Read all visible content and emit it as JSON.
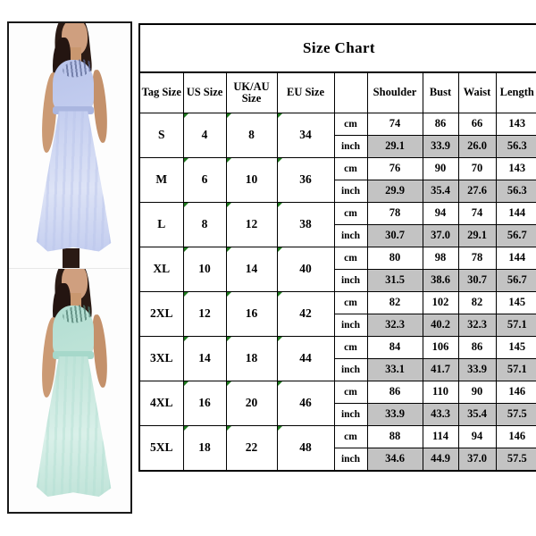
{
  "chart_data": {
    "type": "table",
    "title": "Size Chart",
    "unit_labels": [
      "cm",
      "inch"
    ],
    "columns": [
      "Tag Size",
      "US Size",
      "UK/AU Size",
      "EU Size",
      "",
      "Shoulder",
      "Bust",
      "Waist",
      "Length"
    ],
    "measure_columns": [
      "Shoulder",
      "Bust",
      "Waist",
      "Length"
    ],
    "rows": [
      {
        "tag": "S",
        "us": "4",
        "uk_au": "8",
        "eu": "34",
        "cm": {
          "shoulder": "74",
          "bust": "86",
          "waist": "66",
          "length": "143"
        },
        "inch": {
          "shoulder": "29.1",
          "bust": "33.9",
          "waist": "26.0",
          "length": "56.3"
        }
      },
      {
        "tag": "M",
        "us": "6",
        "uk_au": "10",
        "eu": "36",
        "cm": {
          "shoulder": "76",
          "bust": "90",
          "waist": "70",
          "length": "143"
        },
        "inch": {
          "shoulder": "29.9",
          "bust": "35.4",
          "waist": "27.6",
          "length": "56.3"
        }
      },
      {
        "tag": "L",
        "us": "8",
        "uk_au": "12",
        "eu": "38",
        "cm": {
          "shoulder": "78",
          "bust": "94",
          "waist": "74",
          "length": "144"
        },
        "inch": {
          "shoulder": "30.7",
          "bust": "37.0",
          "waist": "29.1",
          "length": "56.7"
        }
      },
      {
        "tag": "XL",
        "us": "10",
        "uk_au": "14",
        "eu": "40",
        "cm": {
          "shoulder": "80",
          "bust": "98",
          "waist": "78",
          "length": "144"
        },
        "inch": {
          "shoulder": "31.5",
          "bust": "38.6",
          "waist": "30.7",
          "length": "56.7"
        }
      },
      {
        "tag": "2XL",
        "us": "12",
        "uk_au": "16",
        "eu": "42",
        "cm": {
          "shoulder": "82",
          "bust": "102",
          "waist": "82",
          "length": "145"
        },
        "inch": {
          "shoulder": "32.3",
          "bust": "40.2",
          "waist": "32.3",
          "length": "57.1"
        }
      },
      {
        "tag": "3XL",
        "us": "14",
        "uk_au": "18",
        "eu": "44",
        "cm": {
          "shoulder": "84",
          "bust": "106",
          "waist": "86",
          "length": "145"
        },
        "inch": {
          "shoulder": "33.1",
          "bust": "41.7",
          "waist": "33.9",
          "length": "57.1"
        }
      },
      {
        "tag": "4XL",
        "us": "16",
        "uk_au": "20",
        "eu": "46",
        "cm": {
          "shoulder": "86",
          "bust": "110",
          "waist": "90",
          "length": "146"
        },
        "inch": {
          "shoulder": "33.9",
          "bust": "43.3",
          "waist": "35.4",
          "length": "57.5"
        }
      },
      {
        "tag": "5XL",
        "us": "18",
        "uk_au": "22",
        "eu": "48",
        "cm": {
          "shoulder": "88",
          "bust": "114",
          "waist": "94",
          "length": "146"
        },
        "inch": {
          "shoulder": "34.6",
          "bust": "44.9",
          "waist": "37.0",
          "length": "57.5"
        }
      }
    ]
  },
  "table": {
    "title": "Size Chart",
    "headers": {
      "tag": "Tag Size",
      "us": "US Size",
      "uk_au": "UK/AU Size",
      "eu": "EU Size",
      "unit": "",
      "shoulder": "Shoulder",
      "bust": "Bust",
      "waist": "Waist",
      "length": "Length"
    },
    "units": {
      "cm": "cm",
      "inch": "inch"
    }
  },
  "photos": [
    {
      "alt": "model-wearing-lavender-sleeveless-lace-chiffon-maxi-dress",
      "dress_color": "#c3cdef",
      "dress_color_light": "#dde3f6",
      "bodice_color": "#b9c4ea",
      "bead_color": "#5d6a96",
      "waistband_color": "#aab6e0"
    },
    {
      "alt": "model-wearing-mint-green-sleeveless-lace-chiffon-maxi-dress",
      "dress_color": "#bfe3d8",
      "dress_color_light": "#d9f0e9",
      "bodice_color": "#b2ded2",
      "bead_color": "#4f7e72",
      "waistband_color": "#a6d8ca"
    }
  ],
  "colors": {
    "inch_row_fill": "#c3c3c3",
    "border": "#000000",
    "corner_marker": "#1e7a1e",
    "page_background": "#ffffff"
  }
}
